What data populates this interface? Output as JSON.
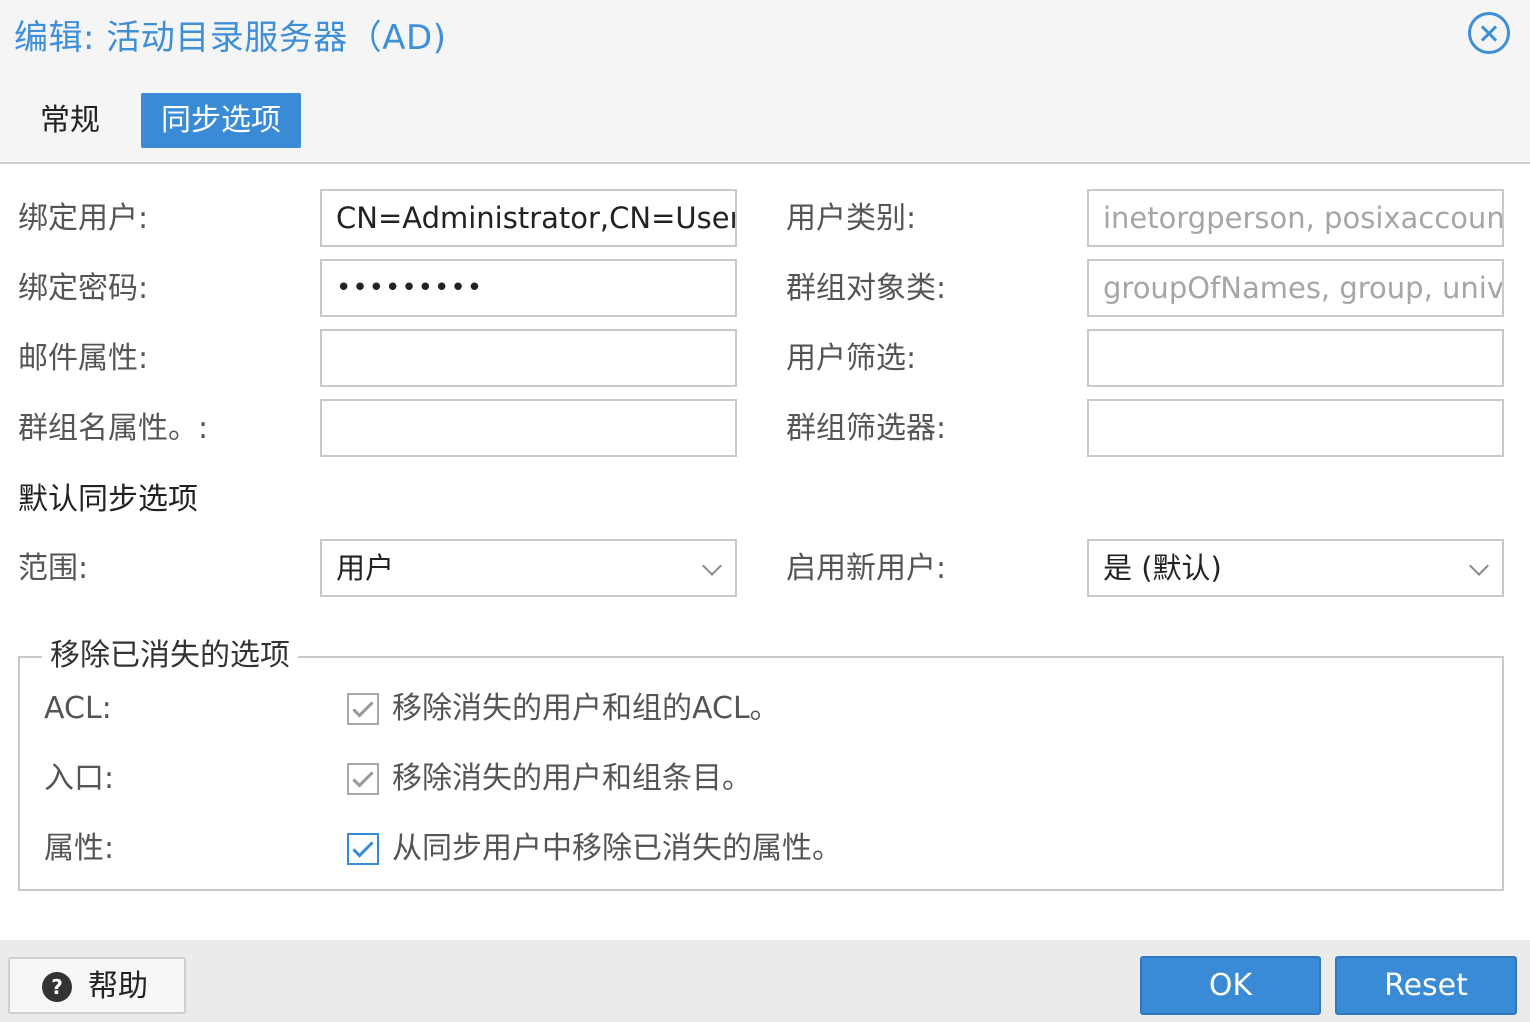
{
  "window": {
    "title": "编辑: 活动目录服务器（AD)"
  },
  "tabs": [
    {
      "label": "常规",
      "active": false
    },
    {
      "label": "同步选项",
      "active": true
    }
  ],
  "form": {
    "bind_user": {
      "label": "绑定用户:",
      "value": "CN=Administrator,CN=Users"
    },
    "bind_password": {
      "label": "绑定密码:",
      "value": "•••••••••"
    },
    "email_attr": {
      "label": "邮件属性:",
      "value": ""
    },
    "group_name_attr": {
      "label": "群组名属性。:",
      "value": ""
    },
    "user_classes": {
      "label": "用户类别:",
      "placeholder": "inetorgperson, posixaccount"
    },
    "group_object_classes": {
      "label": "群组对象类:",
      "placeholder": "groupOfNames, group, univentionGroup"
    },
    "user_filter": {
      "label": "用户筛选:",
      "value": ""
    },
    "group_filter": {
      "label": "群组筛选器:",
      "value": ""
    }
  },
  "defaults_section": {
    "title": "默认同步选项",
    "scope": {
      "label": "范围:",
      "selected": "用户"
    },
    "enable_new": {
      "label": "启用新用户:",
      "selected": "是 (默认)"
    }
  },
  "remove_vanished": {
    "legend": "移除已消失的选项",
    "items": [
      {
        "label": "ACL:",
        "text": "移除消失的用户和组的ACL。",
        "checked": true,
        "state": "disabled"
      },
      {
        "label": "入口:",
        "text": "移除消失的用户和组条目。",
        "checked": true,
        "state": "disabled"
      },
      {
        "label": "属性:",
        "text": "从同步用户中移除已消失的属性。",
        "checked": true,
        "state": "active"
      }
    ]
  },
  "footer": {
    "help_label": "帮助",
    "ok_label": "OK",
    "reset_label": "Reset"
  },
  "colors": {
    "accent": "#3a8bd6",
    "title": "#3e8fd8",
    "border": "#c9c9c9"
  },
  "icons": {
    "close": "close-circle-icon",
    "help": "question-circle-icon",
    "dropdown": "chevron-down-icon",
    "checkbox": "check-icon"
  }
}
